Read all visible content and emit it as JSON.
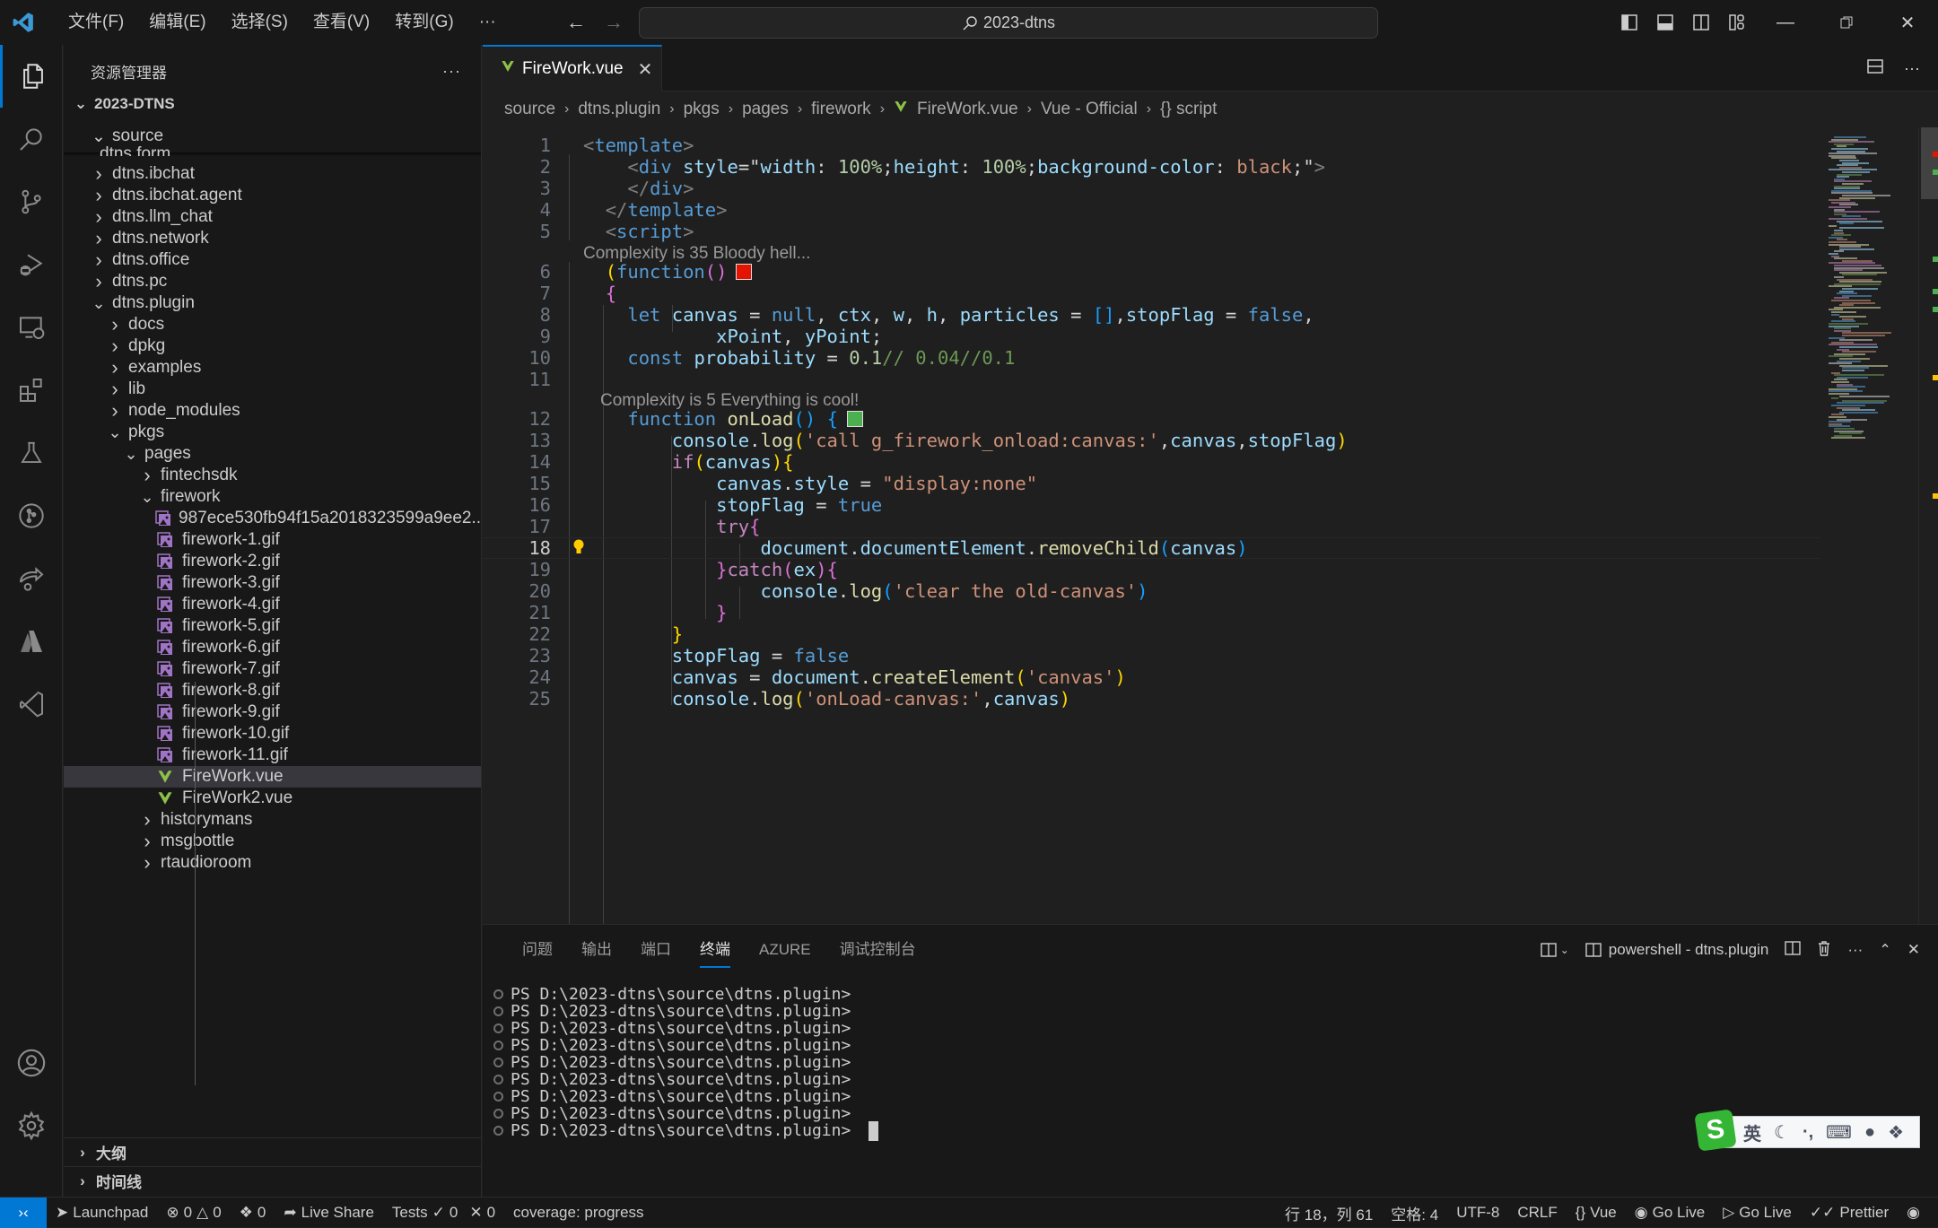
{
  "titlebar": {
    "menu": [
      "文件(F)",
      "编辑(E)",
      "选择(S)",
      "查看(V)",
      "转到(G)",
      "···"
    ],
    "search_text": "2023-dtns"
  },
  "activity": [
    "explorer-icon",
    "search-icon",
    "source-control-icon",
    "run-debug-icon",
    "remote-explorer-icon",
    "extensions-icon",
    "testing-icon",
    "git-graph-icon",
    "live-share-icon",
    "azure-icon",
    "visual-studio-icon"
  ],
  "sidebar": {
    "title": "资源管理器",
    "more": "···",
    "root": "2023-DTNS",
    "sticky": "source",
    "partial": "dtns.form",
    "items": [
      {
        "label": "dtns.ibchat",
        "depth": 1,
        "type": "folder",
        "open": false
      },
      {
        "label": "dtns.ibchat.agent",
        "depth": 1,
        "type": "folder",
        "open": false
      },
      {
        "label": "dtns.llm_chat",
        "depth": 1,
        "type": "folder",
        "open": false
      },
      {
        "label": "dtns.network",
        "depth": 1,
        "type": "folder",
        "open": false
      },
      {
        "label": "dtns.office",
        "depth": 1,
        "type": "folder",
        "open": false
      },
      {
        "label": "dtns.pc",
        "depth": 1,
        "type": "folder",
        "open": false
      },
      {
        "label": "dtns.plugin",
        "depth": 1,
        "type": "folder",
        "open": true
      },
      {
        "label": "docs",
        "depth": 2,
        "type": "folder",
        "open": false
      },
      {
        "label": "dpkg",
        "depth": 2,
        "type": "folder",
        "open": false
      },
      {
        "label": "examples",
        "depth": 2,
        "type": "folder",
        "open": false
      },
      {
        "label": "lib",
        "depth": 2,
        "type": "folder",
        "open": false
      },
      {
        "label": "node_modules",
        "depth": 2,
        "type": "folder",
        "open": false
      },
      {
        "label": "pkgs",
        "depth": 2,
        "type": "folder",
        "open": true
      },
      {
        "label": "pages",
        "depth": 3,
        "type": "folder",
        "open": true
      },
      {
        "label": "fintechsdk",
        "depth": 4,
        "type": "folder",
        "open": false
      },
      {
        "label": "firework",
        "depth": 4,
        "type": "folder",
        "open": true
      },
      {
        "label": "987ece530fb94f15a2018323599a9ee2....",
        "depth": 5,
        "type": "image"
      },
      {
        "label": "firework-1.gif",
        "depth": 5,
        "type": "image"
      },
      {
        "label": "firework-2.gif",
        "depth": 5,
        "type": "image"
      },
      {
        "label": "firework-3.gif",
        "depth": 5,
        "type": "image"
      },
      {
        "label": "firework-4.gif",
        "depth": 5,
        "type": "image"
      },
      {
        "label": "firework-5.gif",
        "depth": 5,
        "type": "image"
      },
      {
        "label": "firework-6.gif",
        "depth": 5,
        "type": "image"
      },
      {
        "label": "firework-7.gif",
        "depth": 5,
        "type": "image"
      },
      {
        "label": "firework-8.gif",
        "depth": 5,
        "type": "image"
      },
      {
        "label": "firework-9.gif",
        "depth": 5,
        "type": "image"
      },
      {
        "label": "firework-10.gif",
        "depth": 5,
        "type": "image"
      },
      {
        "label": "firework-11.gif",
        "depth": 5,
        "type": "image"
      },
      {
        "label": "FireWork.vue",
        "depth": 5,
        "type": "vue",
        "selected": true
      },
      {
        "label": "FireWork2.vue",
        "depth": 5,
        "type": "vue"
      },
      {
        "label": "historymans",
        "depth": 4,
        "type": "folder",
        "open": false
      },
      {
        "label": "msgbottle",
        "depth": 4,
        "type": "folder",
        "open": false
      },
      {
        "label": "rtaudioroom",
        "depth": 4,
        "type": "folder",
        "open": false
      }
    ],
    "sections": [
      "大纲",
      "时间线"
    ]
  },
  "editor": {
    "tab": "FireWork.vue",
    "breadcrumb": [
      "source",
      "dtns.plugin",
      "pkgs",
      "pages",
      "firework",
      "FireWork.vue",
      "Vue - Official",
      "{} script"
    ],
    "codelens": {
      "before_6": "Complexity is 35 Bloody hell...",
      "before_12": "Complexity is 5 Everything is cool!"
    },
    "complexity_colors": {
      "bad": "#e51400",
      "good": "#4caf50"
    },
    "current_line": 18,
    "lines": [
      {
        "n": "1",
        "tokens": [
          [
            "t-brk",
            "<"
          ],
          [
            "t-tag",
            "template"
          ],
          [
            "t-brk",
            ">"
          ]
        ]
      },
      {
        "n": "2",
        "tokens": [
          [
            "t-txt",
            "    "
          ],
          [
            "t-brk",
            "<"
          ],
          [
            "t-tag",
            "div"
          ],
          [
            "t-txt",
            " "
          ],
          [
            "t-attr",
            "style"
          ],
          [
            "t-txt",
            "=\""
          ],
          [
            "t-attr",
            "width"
          ],
          [
            "t-txt",
            ": "
          ],
          [
            "t-num",
            "100%"
          ],
          [
            "t-txt",
            ";"
          ],
          [
            "t-attr",
            "height"
          ],
          [
            "t-txt",
            ": "
          ],
          [
            "t-num",
            "100%"
          ],
          [
            "t-txt",
            ";"
          ],
          [
            "t-attr",
            "background-color"
          ],
          [
            "t-txt",
            ": "
          ],
          [
            "t-str",
            "black"
          ],
          [
            "t-txt",
            ";\""
          ],
          [
            "t-brk",
            ">"
          ]
        ]
      },
      {
        "n": "3",
        "tokens": [
          [
            "t-txt",
            "    "
          ],
          [
            "t-brk",
            "</"
          ],
          [
            "t-tag",
            "div"
          ],
          [
            "t-brk",
            ">"
          ]
        ]
      },
      {
        "n": "4",
        "tokens": [
          [
            "t-txt",
            "  "
          ],
          [
            "t-brk",
            "</"
          ],
          [
            "t-tag",
            "template"
          ],
          [
            "t-brk",
            ">"
          ]
        ]
      },
      {
        "n": "5",
        "tokens": [
          [
            "t-txt",
            "  "
          ],
          [
            "t-brk",
            "<"
          ],
          [
            "t-tag",
            "script"
          ],
          [
            "t-brk",
            ">"
          ]
        ]
      },
      {
        "n": "6",
        "tokens": [
          [
            "t-txt",
            "  "
          ],
          [
            "t-p1",
            "("
          ],
          [
            "t-kw",
            "function"
          ],
          [
            "t-p2",
            "()"
          ]
        ]
      },
      {
        "n": "7",
        "tokens": [
          [
            "t-txt",
            "  "
          ],
          [
            "t-p2",
            "{"
          ]
        ]
      },
      {
        "n": "8",
        "tokens": [
          [
            "t-txt",
            "    "
          ],
          [
            "t-kw",
            "let"
          ],
          [
            "t-txt",
            " "
          ],
          [
            "t-var",
            "canvas"
          ],
          [
            "t-txt",
            " = "
          ],
          [
            "t-kw",
            "null"
          ],
          [
            "t-txt",
            ", "
          ],
          [
            "t-var",
            "ctx"
          ],
          [
            "t-txt",
            ", "
          ],
          [
            "t-var",
            "w"
          ],
          [
            "t-txt",
            ", "
          ],
          [
            "t-var",
            "h"
          ],
          [
            "t-txt",
            ", "
          ],
          [
            "t-var",
            "particles"
          ],
          [
            "t-txt",
            " = "
          ],
          [
            "t-p3",
            "[]"
          ],
          [
            "t-txt",
            ","
          ],
          [
            "t-var",
            "stopFlag"
          ],
          [
            "t-txt",
            " = "
          ],
          [
            "t-kw",
            "false"
          ],
          [
            "t-txt",
            ","
          ]
        ]
      },
      {
        "n": "9",
        "tokens": [
          [
            "t-txt",
            "            "
          ],
          [
            "t-var",
            "xPoint"
          ],
          [
            "t-txt",
            ", "
          ],
          [
            "t-var",
            "yPoint"
          ],
          [
            "t-txt",
            ";"
          ]
        ]
      },
      {
        "n": "10",
        "tokens": [
          [
            "t-txt",
            "    "
          ],
          [
            "t-kw",
            "const"
          ],
          [
            "t-txt",
            " "
          ],
          [
            "t-var",
            "probability"
          ],
          [
            "t-txt",
            " = "
          ],
          [
            "t-num",
            "0.1"
          ],
          [
            "t-cm",
            "// 0.04//0.1"
          ]
        ]
      },
      {
        "n": "11",
        "tokens": []
      },
      {
        "n": "12",
        "tokens": [
          [
            "t-txt",
            "    "
          ],
          [
            "t-kw",
            "function"
          ],
          [
            "t-txt",
            " "
          ],
          [
            "t-fn",
            "onLoad"
          ],
          [
            "t-p3",
            "()"
          ],
          [
            "t-txt",
            " "
          ],
          [
            "t-p3",
            "{"
          ]
        ]
      },
      {
        "n": "13",
        "tokens": [
          [
            "t-txt",
            "        "
          ],
          [
            "t-var",
            "console"
          ],
          [
            "t-txt",
            "."
          ],
          [
            "t-fn",
            "log"
          ],
          [
            "t-p1",
            "("
          ],
          [
            "t-str",
            "'call g_firework_onload:canvas:'"
          ],
          [
            "t-txt",
            ","
          ],
          [
            "t-var",
            "canvas"
          ],
          [
            "t-txt",
            ","
          ],
          [
            "t-var",
            "stopFlag"
          ],
          [
            "t-p1",
            ")"
          ]
        ]
      },
      {
        "n": "14",
        "tokens": [
          [
            "t-txt",
            "        "
          ],
          [
            "t-ctl",
            "if"
          ],
          [
            "t-p1",
            "("
          ],
          [
            "t-var",
            "canvas"
          ],
          [
            "t-p1",
            "){"
          ]
        ]
      },
      {
        "n": "15",
        "tokens": [
          [
            "t-txt",
            "            "
          ],
          [
            "t-var",
            "canvas"
          ],
          [
            "t-txt",
            "."
          ],
          [
            "t-var",
            "style"
          ],
          [
            "t-txt",
            " = "
          ],
          [
            "t-str",
            "\"display:none\""
          ]
        ]
      },
      {
        "n": "16",
        "tokens": [
          [
            "t-txt",
            "            "
          ],
          [
            "t-var",
            "stopFlag"
          ],
          [
            "t-txt",
            " = "
          ],
          [
            "t-kw",
            "true"
          ]
        ]
      },
      {
        "n": "17",
        "tokens": [
          [
            "t-txt",
            "            "
          ],
          [
            "t-ctl",
            "try"
          ],
          [
            "t-p2",
            "{"
          ]
        ]
      },
      {
        "n": "18",
        "tokens": [
          [
            "t-txt",
            "                "
          ],
          [
            "t-var",
            "document"
          ],
          [
            "t-txt",
            "."
          ],
          [
            "t-var",
            "documentElement"
          ],
          [
            "t-txt",
            "."
          ],
          [
            "t-fn",
            "removeChild"
          ],
          [
            "t-p3",
            "("
          ],
          [
            "t-var",
            "canvas"
          ],
          [
            "t-p3",
            ")"
          ]
        ]
      },
      {
        "n": "19",
        "tokens": [
          [
            "t-txt",
            "            "
          ],
          [
            "t-p2",
            "}"
          ],
          [
            "t-ctl",
            "catch"
          ],
          [
            "t-p2",
            "("
          ],
          [
            "t-var",
            "ex"
          ],
          [
            "t-p2",
            "){"
          ]
        ]
      },
      {
        "n": "20",
        "tokens": [
          [
            "t-txt",
            "                "
          ],
          [
            "t-var",
            "console"
          ],
          [
            "t-txt",
            "."
          ],
          [
            "t-fn",
            "log"
          ],
          [
            "t-p3",
            "("
          ],
          [
            "t-str",
            "'clear the old-canvas'"
          ],
          [
            "t-p3",
            ")"
          ]
        ]
      },
      {
        "n": "21",
        "tokens": [
          [
            "t-txt",
            "            "
          ],
          [
            "t-p2",
            "}"
          ]
        ]
      },
      {
        "n": "22",
        "tokens": [
          [
            "t-txt",
            "        "
          ],
          [
            "t-p1",
            "}"
          ]
        ]
      },
      {
        "n": "23",
        "tokens": [
          [
            "t-txt",
            "        "
          ],
          [
            "t-var",
            "stopFlag"
          ],
          [
            "t-txt",
            " = "
          ],
          [
            "t-kw",
            "false"
          ]
        ]
      },
      {
        "n": "24",
        "tokens": [
          [
            "t-txt",
            "        "
          ],
          [
            "t-var",
            "canvas"
          ],
          [
            "t-txt",
            " = "
          ],
          [
            "t-var",
            "document"
          ],
          [
            "t-txt",
            "."
          ],
          [
            "t-fn",
            "createElement"
          ],
          [
            "t-p1",
            "("
          ],
          [
            "t-str",
            "'canvas'"
          ],
          [
            "t-p1",
            ")"
          ]
        ]
      },
      {
        "n": "25",
        "tokens": [
          [
            "t-txt",
            "        "
          ],
          [
            "t-var",
            "console"
          ],
          [
            "t-txt",
            "."
          ],
          [
            "t-fn",
            "log"
          ],
          [
            "t-p1",
            "("
          ],
          [
            "t-str",
            "'onLoad-canvas:'"
          ],
          [
            "t-txt",
            ","
          ],
          [
            "t-var",
            "canvas"
          ],
          [
            "t-p1",
            ")"
          ]
        ]
      }
    ]
  },
  "panel": {
    "tabs": [
      "问题",
      "输出",
      "端口",
      "终端",
      "AZURE",
      "调试控制台"
    ],
    "active_tab": "终端",
    "terminal_name": "powershell - dtns.plugin",
    "prompt": "PS D:\\2023-dtns\\source\\dtns.plugin>",
    "prompt_count": 9
  },
  "statusbar": {
    "left": {
      "launchpad": "Launchpad",
      "errors": "0",
      "warnings": "0",
      "ports": "0",
      "live_share": "Live Share",
      "tests_label": "Tests",
      "tests_passed": "0",
      "tests_failed": "0",
      "coverage": "coverage: progress"
    },
    "right": {
      "position": "行 18，列 61",
      "indent": "空格: 4",
      "encoding": "UTF-8",
      "eol": "CRLF",
      "language": "Vue",
      "go_live_1": "Go Live",
      "go_live_2": "Go Live",
      "prettier": "Prettier"
    }
  },
  "ime": {
    "logo": "S",
    "lang": "英"
  }
}
